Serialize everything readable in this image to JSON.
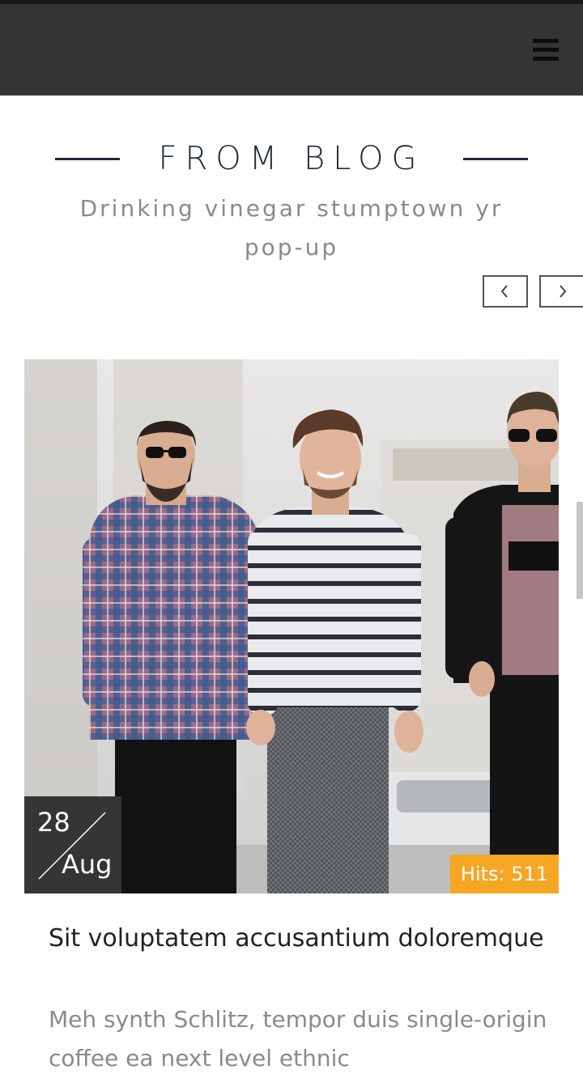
{
  "header": {
    "menu_icon": "hamburger-menu-icon",
    "background_color": "#343434"
  },
  "section": {
    "title": "FROM BLOG",
    "subtitle": "Drinking vinegar stumptown yr pop-up",
    "prev_icon": "chevron-left-icon",
    "next_icon": "chevron-right-icon"
  },
  "post": {
    "date_day": "28",
    "date_month": "Aug",
    "hits_label": "Hits: 511",
    "title": "Sit voluptatem accusantium doloremque",
    "excerpt": "Meh synth Schlitz, tempor duis single-origin coffee ea next level ethnic",
    "accent_color": "#f6a623"
  }
}
